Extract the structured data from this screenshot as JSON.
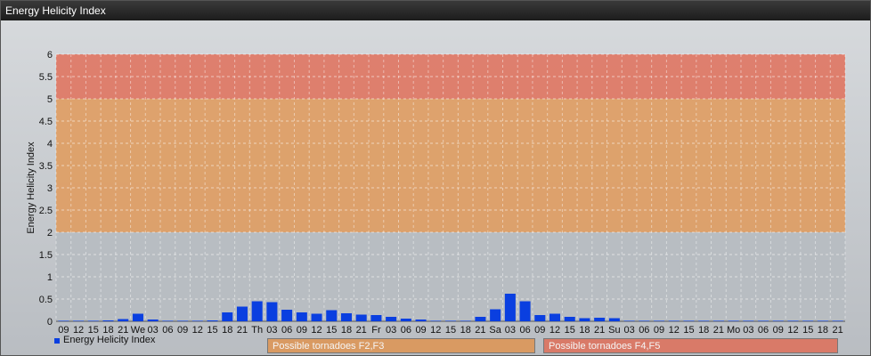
{
  "window": {
    "title": "Energy Helicity Index"
  },
  "colors": {
    "series": "#0a3fe0",
    "band_low": "#b8bdc2",
    "band_mid": "#e09a5a",
    "band_high": "#e0705a"
  },
  "legend": {
    "label": "Energy Helicity Index"
  },
  "bands": [
    {
      "label": "Possible tornadoes F2,F3",
      "from": 2,
      "to": 5,
      "color": "#d99a62"
    },
    {
      "label": "Possible tornadoes F4,F5",
      "from": 5,
      "to": 6,
      "color": "#d97a68"
    }
  ],
  "chart_data": {
    "type": "bar",
    "title": "",
    "xlabel": "",
    "ylabel": "Energy Helicity Index",
    "ylim": [
      0,
      6
    ],
    "yticks": [
      "0",
      "0.5",
      "1",
      "1.5",
      "2",
      "2.5",
      "3",
      "3.5",
      "4",
      "4.5",
      "5",
      "5.5",
      "6"
    ],
    "grid": true,
    "categories": [
      "09",
      "12",
      "15",
      "18",
      "21",
      "We",
      "03",
      "06",
      "09",
      "12",
      "15",
      "18",
      "21",
      "Th",
      "03",
      "06",
      "09",
      "12",
      "15",
      "18",
      "21",
      "Fr",
      "03",
      "06",
      "09",
      "12",
      "15",
      "18",
      "21",
      "Sa",
      "03",
      "06",
      "09",
      "12",
      "15",
      "18",
      "21",
      "Su",
      "03",
      "06",
      "09",
      "12",
      "15",
      "18",
      "21",
      "Mo",
      "03",
      "06",
      "09",
      "12",
      "15",
      "18",
      "21"
    ],
    "series": [
      {
        "name": "Energy Helicity Index",
        "values": [
          0.01,
          0.01,
          0.01,
          0.02,
          0.05,
          0.17,
          0.04,
          0.01,
          0.01,
          0.01,
          0.02,
          0.2,
          0.33,
          0.45,
          0.43,
          0.26,
          0.2,
          0.17,
          0.25,
          0.18,
          0.15,
          0.14,
          0.1,
          0.06,
          0.04,
          0.01,
          0.01,
          0.01,
          0.1,
          0.27,
          0.62,
          0.45,
          0.14,
          0.17,
          0.1,
          0.07,
          0.08,
          0.07,
          0.01,
          0.01,
          0.01,
          0.01,
          0.01,
          0.01,
          0.01,
          0.01,
          0.01,
          0.01,
          0.01,
          0.01,
          0.01,
          0.01,
          0.01
        ]
      }
    ]
  }
}
